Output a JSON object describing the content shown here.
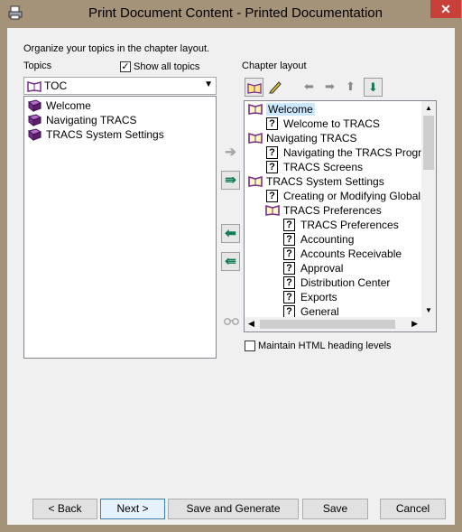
{
  "window": {
    "title": "Print Document Content - Printed Documentation",
    "close_glyph": "✕"
  },
  "instructions": "Organize your topics in the chapter layout.",
  "topics": {
    "label": "Topics",
    "show_all_label": "Show all topics",
    "show_all_checked": true,
    "combo_value": "TOC",
    "items": [
      "Welcome",
      "Navigating TRACS",
      "TRACS System Settings"
    ]
  },
  "chapter": {
    "label": "Chapter layout",
    "items": [
      {
        "label": "Welcome",
        "type": "book",
        "indent": 0,
        "selected": true
      },
      {
        "label": "Welcome to TRACS",
        "type": "topic",
        "indent": 1
      },
      {
        "label": "Navigating TRACS",
        "type": "book",
        "indent": 0
      },
      {
        "label": "Navigating the TRACS Program",
        "type": "topic",
        "indent": 1
      },
      {
        "label": "TRACS Screens",
        "type": "topic",
        "indent": 1
      },
      {
        "label": "TRACS System Settings",
        "type": "book",
        "indent": 0
      },
      {
        "label": "Creating or Modifying Global Set",
        "type": "topic",
        "indent": 1
      },
      {
        "label": "TRACS Preferences",
        "type": "book",
        "indent": 1
      },
      {
        "label": "TRACS Preferences",
        "type": "topic",
        "indent": 2
      },
      {
        "label": "Accounting",
        "type": "topic",
        "indent": 2
      },
      {
        "label": "Accounts Receivable",
        "type": "topic",
        "indent": 2
      },
      {
        "label": "Approval",
        "type": "topic",
        "indent": 2
      },
      {
        "label": "Distribution Center",
        "type": "topic",
        "indent": 2
      },
      {
        "label": "Exports",
        "type": "topic",
        "indent": 2
      },
      {
        "label": "General",
        "type": "topic",
        "indent": 2
      }
    ],
    "maintain_html_label": "Maintain HTML heading levels",
    "maintain_html_checked": false
  },
  "buttons": {
    "back": "< Back",
    "next": "Next >",
    "save_generate": "Save and Generate",
    "save": "Save",
    "cancel": "Cancel"
  },
  "colors": {
    "book": "#7b2d8e",
    "selection": "#cce8ff",
    "arrow_green": "#127b52"
  }
}
